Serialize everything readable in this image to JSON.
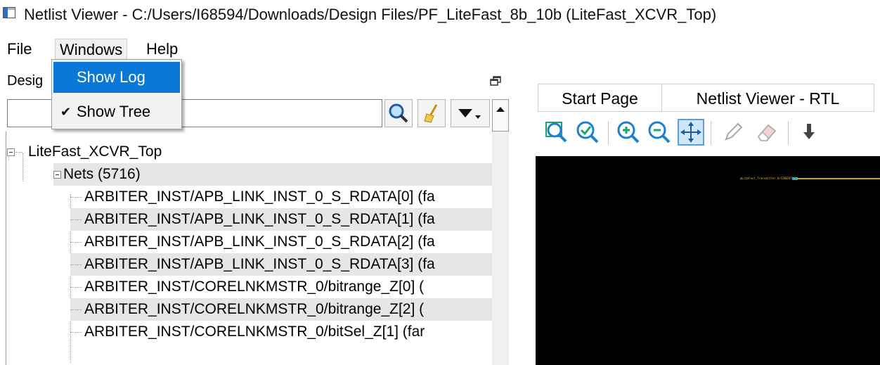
{
  "window": {
    "title": "Netlist Viewer - C:/Users/I68594/Downloads/Design Files/PF_LiteFast_8b_10b (LiteFast_XCVR_Top)"
  },
  "menubar": {
    "file": "File",
    "windows": "Windows",
    "help": "Help"
  },
  "windows_menu": {
    "items": [
      {
        "label": "Show Log",
        "checked": false,
        "highlighted": true
      },
      {
        "label": "Show Tree",
        "checked": true,
        "highlighted": false
      }
    ],
    "check_glyph": "✔"
  },
  "design_dock": {
    "title": "Desig",
    "search": {
      "value": "",
      "placeholder": ""
    },
    "icons": [
      "search-icon",
      "broom-clear-icon",
      "dropdown-arrow-icon",
      "float-window-icon"
    ]
  },
  "tree": {
    "root": "LiteFast_XCVR_Top",
    "nets_group": "Nets (5716)",
    "nets": [
      "ARBITER_INST/APB_LINK_INST_0_S_RDATA[0] (fa",
      "ARBITER_INST/APB_LINK_INST_0_S_RDATA[1] (fa",
      "ARBITER_INST/APB_LINK_INST_0_S_RDATA[2] (fa",
      "ARBITER_INST/APB_LINK_INST_0_S_RDATA[3] (fa",
      "ARBITER_INST/CORELNKMSTR_0/bitrange_Z[0] (",
      "ARBITER_INST/CORELNKMSTR_0/bitrange_Z[2] (",
      "ARBITER_INST/CORELNKMSTR_0/bitSel_Z[1] (far"
    ]
  },
  "viewer": {
    "tabs": [
      "Start Page",
      "Netlist Viewer - RTL"
    ],
    "toolbar_icons": [
      "zoom-fit-icon",
      "zoom-selection-icon",
      "zoom-in-icon",
      "zoom-out-icon",
      "pan-icon",
      "pencil-icon",
      "eraser-icon",
      "down-arrow-icon"
    ],
    "canvas_label": "@LiteFast_Transmitter_0/CORERFF",
    "colors": {
      "canvas": "#000000",
      "wire": "#c8a800",
      "pin": "#3aa6c8"
    }
  },
  "colors": {
    "menu_highlight": "#0a78d7",
    "selected_row": "#e6e6e6"
  }
}
